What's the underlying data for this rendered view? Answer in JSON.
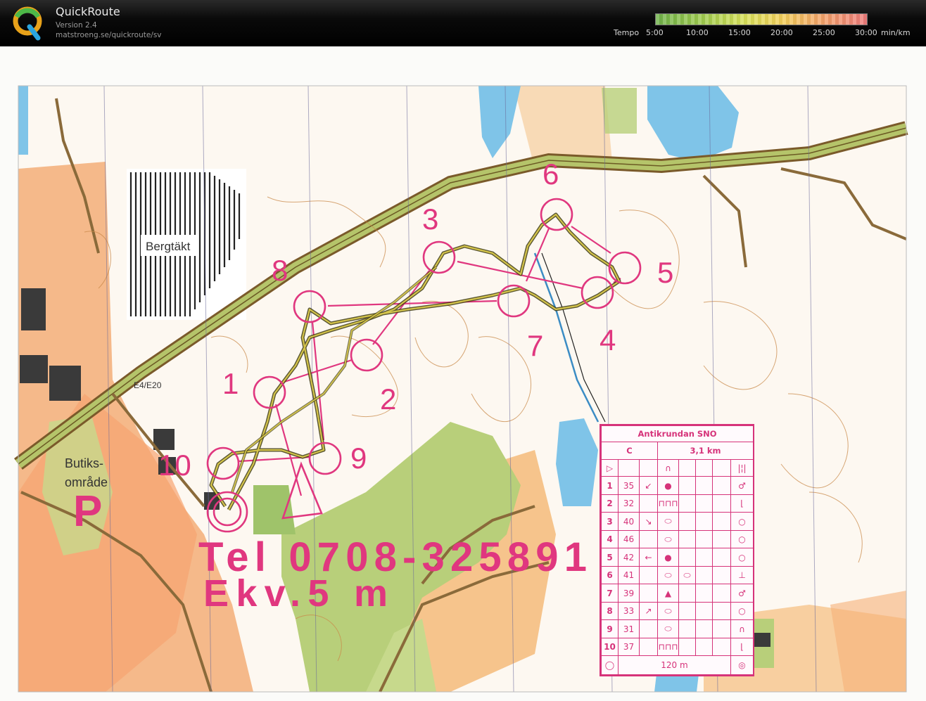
{
  "app": {
    "title": "QuickRoute",
    "version": "Version 2.4",
    "url": "matstroeng.se/quickroute/sv"
  },
  "tempo": {
    "label": "Tempo",
    "ticks": [
      "5:00",
      "10:00",
      "15:00",
      "20:00",
      "25:00",
      "30:00"
    ],
    "unit": "min/km"
  },
  "map": {
    "labels": {
      "quarry": "Bergtäkt",
      "road": "E4/E20",
      "shopping_line1": "Butiks-",
      "shopping_line2": "område",
      "parking": "P",
      "phone": "Tel 0708-325891",
      "contour": "Ekv.5 m"
    },
    "controls": [
      "1",
      "2",
      "3",
      "4",
      "5",
      "6",
      "7",
      "8",
      "9",
      "10"
    ]
  },
  "legend": {
    "title": "Antikrundan SNO",
    "class": "C",
    "length": "3,1 km",
    "finish_distance": "120 m",
    "rows": [
      {
        "num": "1",
        "code": "35",
        "dir": "↙",
        "feature": "●",
        "detail": "",
        "extra": "♂"
      },
      {
        "num": "2",
        "code": "32",
        "dir": "",
        "feature": "⊓⊓⊓",
        "detail": "",
        "extra": "⌊"
      },
      {
        "num": "3",
        "code": "40",
        "dir": "↘",
        "feature": "⬭",
        "detail": "",
        "extra": "○"
      },
      {
        "num": "4",
        "code": "46",
        "dir": "",
        "feature": "⬭",
        "detail": "",
        "extra": "○"
      },
      {
        "num": "5",
        "code": "42",
        "dir": "←",
        "feature": "●",
        "detail": "",
        "extra": "○"
      },
      {
        "num": "6",
        "code": "41",
        "dir": "",
        "feature": "⬭",
        "detail": "⬭",
        "extra": "⊥"
      },
      {
        "num": "7",
        "code": "39",
        "dir": "",
        "feature": "▲",
        "detail": "",
        "extra": "♂"
      },
      {
        "num": "8",
        "code": "33",
        "dir": "↗",
        "feature": "⬭",
        "detail": "",
        "extra": "○"
      },
      {
        "num": "9",
        "code": "31",
        "dir": "",
        "feature": "⬭",
        "detail": "",
        "extra": "∩"
      },
      {
        "num": "10",
        "code": "37",
        "dir": "",
        "feature": "⊓⊓⊓",
        "detail": "",
        "extra": "⌊"
      }
    ]
  },
  "colors": {
    "course": "#e0377f",
    "route_dark": "#3d3a12",
    "route_light": "#d4c44a",
    "forest_green": "#b8cf7a",
    "open_orange": "#f6c48c",
    "water": "#7fc4e8",
    "road_brown": "#8a6a3a"
  }
}
